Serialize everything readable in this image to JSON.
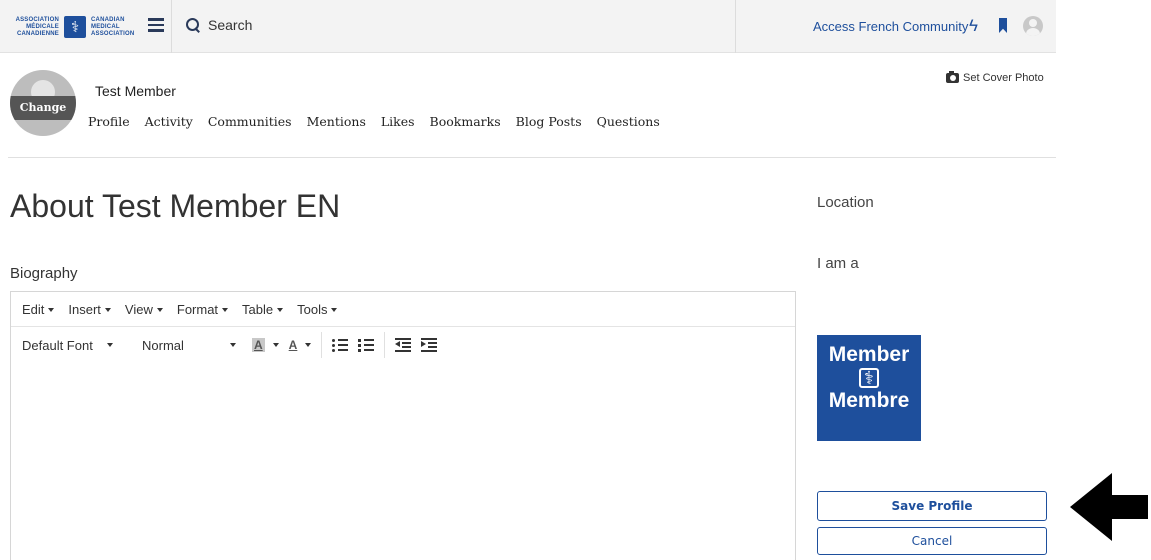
{
  "topbar": {
    "logo": {
      "left_lines": [
        "ASSOCIATION",
        "MÉDICALE",
        "CANADIENNE"
      ],
      "right_lines": [
        "CANADIAN",
        "MEDICAL",
        "ASSOCIATION"
      ],
      "icon": "cma-caduceus-logo"
    },
    "menu_icon": "hamburger-icon",
    "search": {
      "icon": "search-icon",
      "placeholder": "Search"
    },
    "access_french_label": "Access French Community",
    "icons": [
      "bolt-icon",
      "bookmark-icon",
      "user-avatar-icon"
    ]
  },
  "profile": {
    "name": "Test Member",
    "change_label": "Change",
    "set_cover_label": "Set Cover Photo",
    "nav": [
      "Profile",
      "Activity",
      "Communities",
      "Mentions",
      "Likes",
      "Bookmarks",
      "Blog Posts",
      "Questions"
    ]
  },
  "main": {
    "title": "About Test Member EN",
    "biography_label": "Biography",
    "editor": {
      "menus": [
        "Edit",
        "Insert",
        "View",
        "Format",
        "Table",
        "Tools"
      ],
      "font": "Default Font",
      "size": "Normal",
      "bg_color_glyph": "A",
      "fg_color_glyph": "A",
      "content": ""
    }
  },
  "sidebar": {
    "location_label": "Location",
    "iam_label": "I am a",
    "badge": {
      "line1": "Member",
      "line2": "Membre",
      "color": "#1e4f9c"
    },
    "save_label": "Save Profile",
    "cancel_label": "Cancel"
  },
  "colors": {
    "brand": "#1e4f9c",
    "topbar_bg": "#f3f3f3"
  }
}
